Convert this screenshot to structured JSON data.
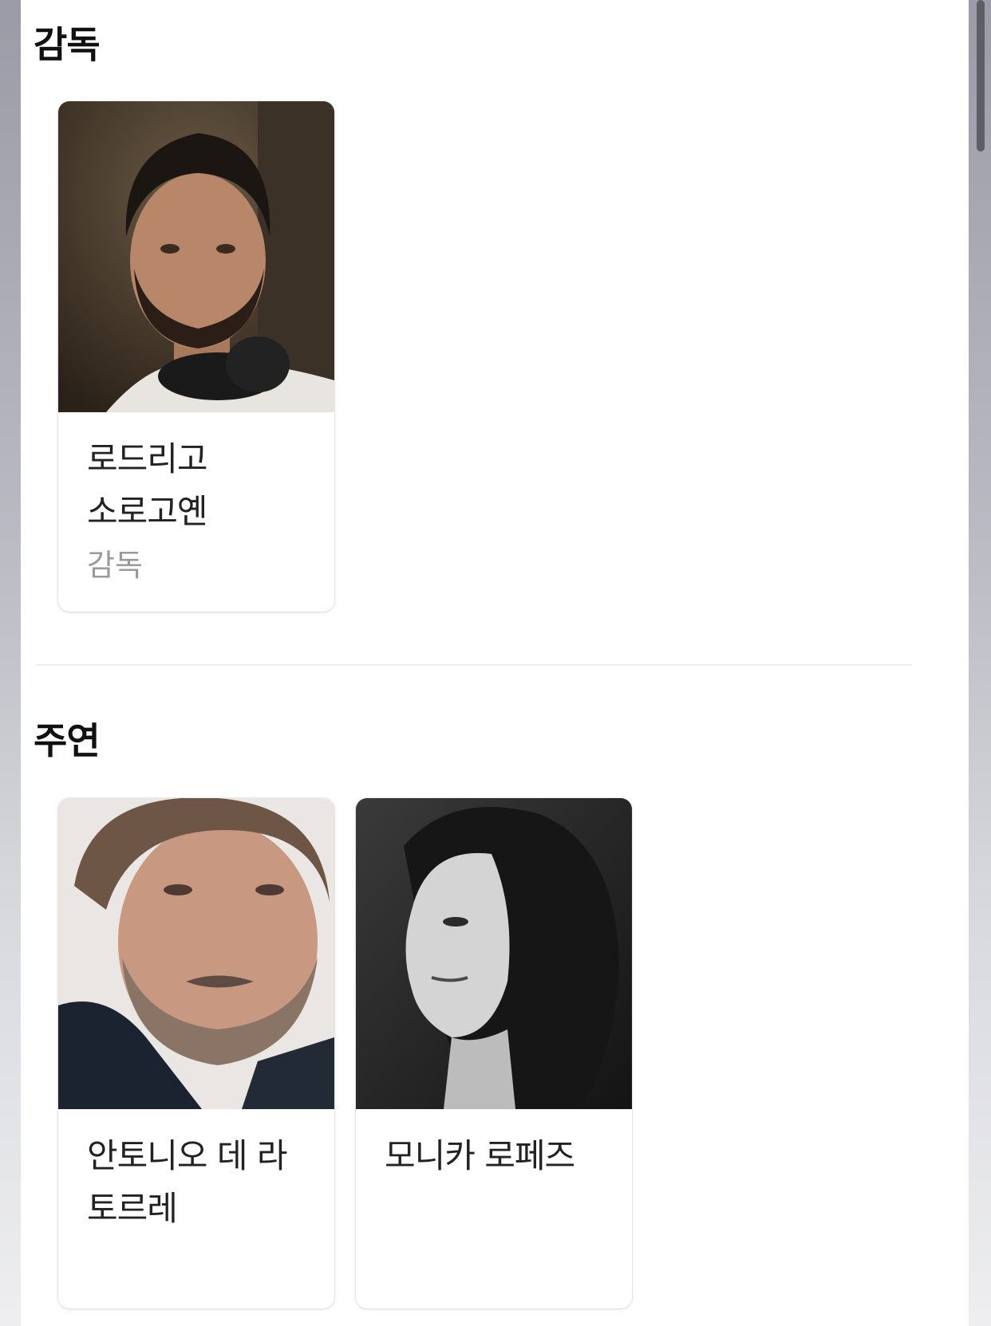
{
  "sections": {
    "director": {
      "title": "감독",
      "people": [
        {
          "name": "로드리고 소로고옌",
          "role": "감독",
          "photo": "director-portrait"
        }
      ]
    },
    "cast": {
      "title": "주연",
      "people": [
        {
          "name": "안토니오 데 라 토르레",
          "role": "",
          "photo": "actor-portrait"
        },
        {
          "name": "모니카 로페즈",
          "role": "",
          "photo": "actress-portrait"
        }
      ]
    }
  }
}
